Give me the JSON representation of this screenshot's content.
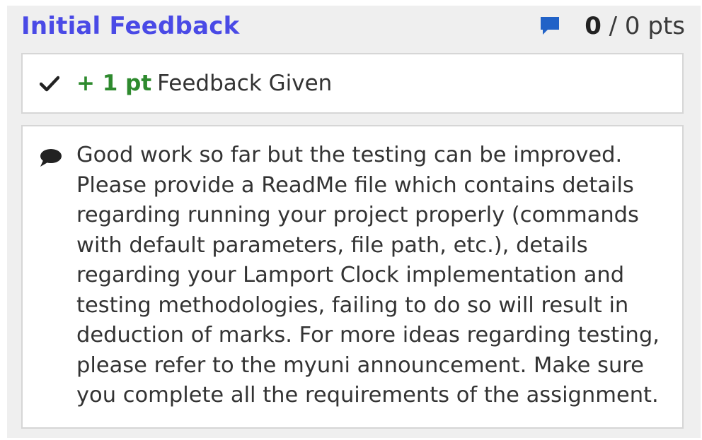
{
  "header": {
    "title": "Initial Feedback",
    "score_earned": "0",
    "score_rest": " / 0 pts"
  },
  "rubric_item": {
    "points": "+ 1 pt",
    "label": "Feedback Given"
  },
  "comment": {
    "lines": [
      "Good work so far but the testing can be improved.",
      "Please provide a ReadMe file which contains details",
      "regarding running your project properly (commands",
      "with default parameters, file path, etc.), details",
      "regarding your Lamport Clock implementation and",
      "testing methodologies, failing to do so will result in",
      "deduction of marks. For more ideas regarding testing,",
      "please refer to the myuni announcement. Make sure",
      "you complete all the requirements of the assignment."
    ]
  },
  "icons": {
    "top": "comment-icon",
    "rubric": "check-icon",
    "comment": "speech-bubble-icon"
  },
  "colors": {
    "title": "#4a4ae6",
    "points": "#2e8a2e",
    "comment_icon": "#2162c7",
    "panel": "#efefef"
  }
}
